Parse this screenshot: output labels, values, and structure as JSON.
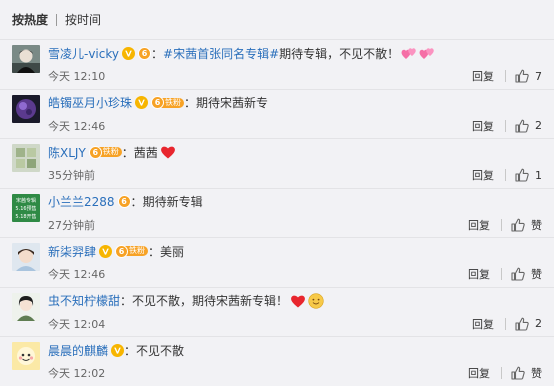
{
  "sort_bar": {
    "hot_label": "按热度",
    "time_label": "按时间"
  },
  "level_pill_text": "铁粉",
  "level_num": "6",
  "colon": "：",
  "reply_label": "回复",
  "colors": {
    "link": "#2a6fbb",
    "badge_v": "#f7b500",
    "badge_level": "#f7a225",
    "background": "#f2f2f5"
  },
  "comments": [
    {
      "username": "雪凌儿-vicky",
      "hashtag": "#宋茜首张同名专辑#",
      "text": " 期待专辑，不见不散！",
      "time": "今天 12:10",
      "like": "7",
      "emojis": [
        "pink-hearts-icon",
        "pink-hearts-icon"
      ]
    },
    {
      "username": "皓镯巫月小珍珠",
      "text": "期待宋茜新专",
      "time": "今天 12:46",
      "like": "2"
    },
    {
      "username": "陈XLJY",
      "text": "茜茜",
      "time": "35分钟前",
      "like": "1",
      "emojis": [
        "red-heart-icon"
      ]
    },
    {
      "username": "小兰兰2288",
      "text": "期待新专辑",
      "time": "27分钟前",
      "like": "赞",
      "avatar_text": [
        "宋茜专辑",
        "5.16预售",
        "5.18开售"
      ]
    },
    {
      "username": "新柒羿肆",
      "text": "美丽",
      "time": "今天 12:46",
      "like": "赞"
    },
    {
      "username": "虫不知柠檬甜",
      "text": "不见不散，期待宋茜新专辑！",
      "time": "今天 12:04",
      "like": "2",
      "emojis": [
        "red-heart-icon",
        "smile-face-icon"
      ]
    },
    {
      "username": "晨晨的麒麟",
      "text": "不见不散",
      "time": "今天 12:02",
      "like": "赞"
    }
  ]
}
